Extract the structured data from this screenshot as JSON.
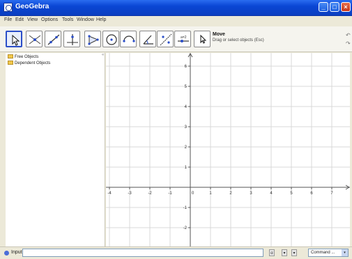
{
  "window": {
    "title": "GeoGebra",
    "minimize": "_",
    "maximize": "□",
    "close": "×"
  },
  "menu": [
    "File",
    "Edit",
    "View",
    "Options",
    "Tools",
    "Window",
    "Help"
  ],
  "toolbar": {
    "active_tool": {
      "name": "Move",
      "help": "Drag or select objects (Esc)"
    },
    "undo_icon": "↶",
    "redo_icon": "↷"
  },
  "algebra": {
    "items": [
      "Free Objects",
      "Dependent Objects"
    ],
    "handle": "«"
  },
  "axes": {
    "x_ticks": [
      "-4",
      "-3",
      "-2",
      "-1",
      "0",
      "1",
      "2",
      "3",
      "4",
      "5",
      "6",
      "7",
      "8"
    ],
    "y_ticks": [
      "8",
      "7",
      "6",
      "5",
      "4",
      "3",
      "2",
      "1",
      "-1",
      "-2"
    ]
  },
  "inputbar": {
    "label": "Input:",
    "value": "",
    "symbol_btn_1": "α",
    "symbol_btn_2": "▾",
    "symbol_btn_3": "▾",
    "command_select": "Command ...",
    "command_arrow": "▾"
  }
}
